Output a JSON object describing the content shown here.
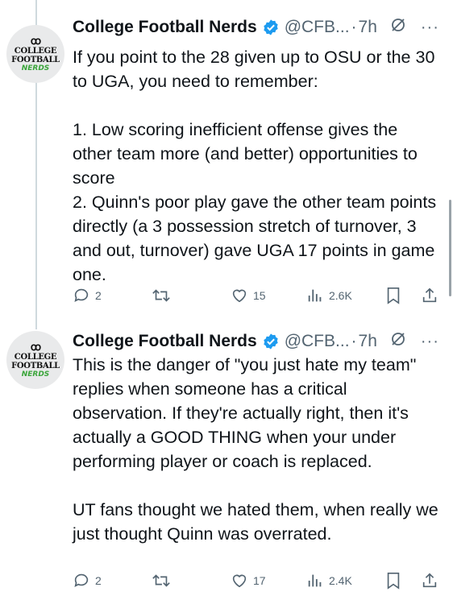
{
  "tweets": [
    {
      "name": "College Football Nerds",
      "handle": "@CFB...",
      "time": "7h",
      "avatar": {
        "line1": "COLLEGE",
        "line2": "FOOTBALL",
        "line3": "NERDS"
      },
      "text": "If you point to the 28 given up to OSU or the 30 to UGA, you need to remember:\n\n1. Low scoring inefficient offense gives the other team more (and better) opportunities to score\n2. Quinn's poor play gave the other team points directly (a 3 possession stretch of turnover, 3 and out, turnover) gave UGA 17 points in game one.",
      "replies": "2",
      "likes": "15",
      "views": "2.6K"
    },
    {
      "name": "College Football Nerds",
      "handle": "@CFB...",
      "time": "7h",
      "avatar": {
        "line1": "COLLEGE",
        "line2": "FOOTBALL",
        "line3": "NERDS"
      },
      "text": "This is the danger of \"you just hate my team\" replies when someone has a critical observation. If they're actually right, then it's actually a GOOD THING when your under performing player or coach is replaced.\n\nUT fans thought we hated them, when really we just thought Quinn was overrated.",
      "replies": "2",
      "likes": "17",
      "views": "2.4K"
    }
  ],
  "separator": "·",
  "colors": {
    "verified": "#1d9bf0",
    "muted": "#536471",
    "accent_green": "#3aa53a"
  },
  "icons": [
    "reply-icon",
    "retweet-icon",
    "like-icon",
    "views-icon",
    "bookmark-icon",
    "share-icon",
    "grok-icon",
    "more-icon",
    "verified-icon"
  ]
}
